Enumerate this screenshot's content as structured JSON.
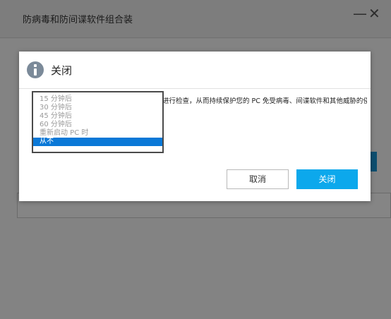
{
  "app": {
    "title": "防病毒和防间谍软件组合装",
    "minimize_glyph": "—",
    "close_glyph": "✕"
  },
  "dialog": {
    "title": "关闭",
    "message": "进行检查，从而持续保护您的 PC 免受病毒、间谍软件和其他威胁的侵",
    "options": [
      "15 分钟后",
      "30 分钟后",
      "45 分钟后",
      "60 分钟后",
      "重新启动 PC 时",
      "从不"
    ],
    "selected_option": "从不",
    "cancel_label": "取消",
    "close_label": "关闭"
  },
  "colors": {
    "accent": "#0ca8ec",
    "selection": "#0a78d7",
    "info_icon": "#7b8a99"
  },
  "icons": {
    "header": "info-icon"
  }
}
